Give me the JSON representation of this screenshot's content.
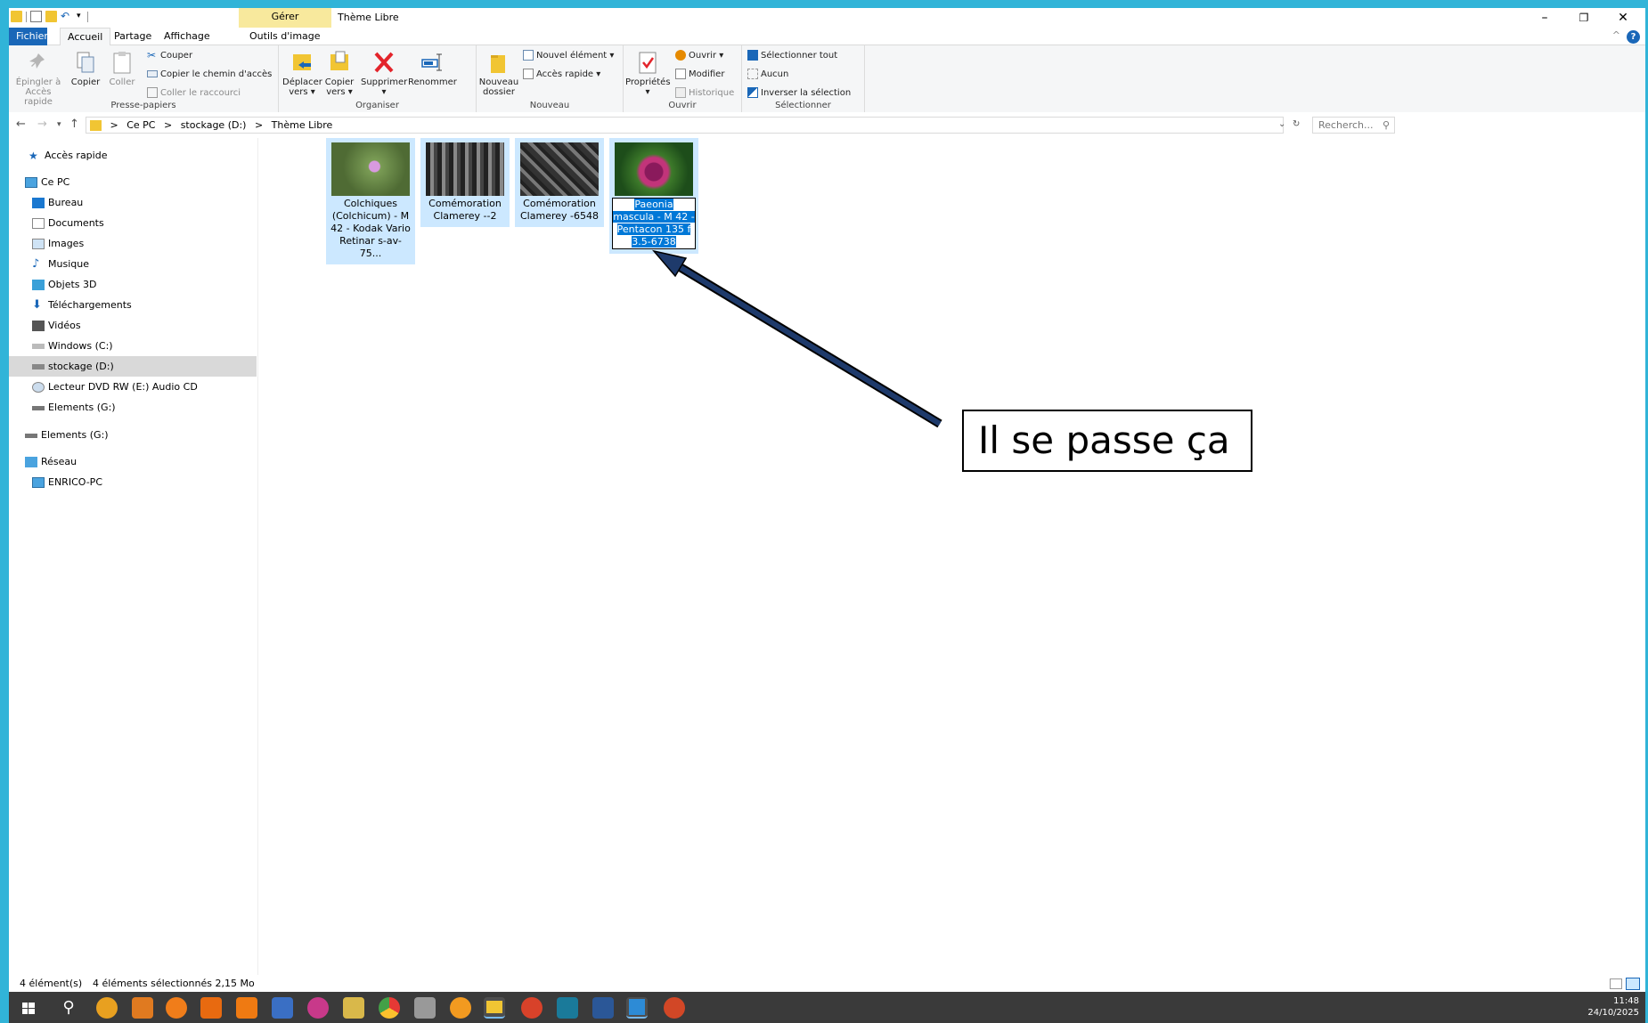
{
  "window": {
    "title": "Thème Libre",
    "contextual_tab_group": "Gérer"
  },
  "tabs": [
    {
      "label": "Fichier"
    },
    {
      "label": "Accueil"
    },
    {
      "label": "Partage"
    },
    {
      "label": "Affichage"
    },
    {
      "label": "Outils d'image"
    }
  ],
  "ribbon": {
    "clipboard": {
      "pin_line1": "Épingler à",
      "pin_line2": "Accès rapide",
      "copy": "Copier",
      "paste": "Coller",
      "cut": "Couper",
      "copy_path": "Copier le chemin d'accès",
      "paste_shortcut": "Coller le raccourci",
      "group": "Presse-papiers"
    },
    "organize": {
      "move_line1": "Déplacer",
      "move_line2": "vers ▾",
      "copyto_line1": "Copier",
      "copyto_line2": "vers ▾",
      "delete": "Supprimer",
      "delete_arrow": "▾",
      "rename": "Renommer",
      "group": "Organiser"
    },
    "new": {
      "newfolder_line1": "Nouveau",
      "newfolder_line2": "dossier",
      "new_item": "Nouvel élément ▾",
      "easy_access": "Accès rapide ▾",
      "group": "Nouveau"
    },
    "open": {
      "properties": "Propriétés",
      "properties_arrow": "▾",
      "open": "Ouvrir ▾",
      "edit": "Modifier",
      "history": "Historique",
      "group": "Ouvrir"
    },
    "select": {
      "select_all": "Sélectionner tout",
      "select_none": "Aucun",
      "invert": "Inverser la sélection",
      "group": "Sélectionner"
    }
  },
  "address": {
    "crumbs": [
      ">",
      "Ce PC",
      ">",
      "stockage (D:)",
      ">",
      "Thème Libre"
    ],
    "search_placeholder": "Recherch..."
  },
  "nav": {
    "items": [
      {
        "label": "Accès rapide"
      },
      {
        "label": "Ce PC"
      },
      {
        "label": "Bureau"
      },
      {
        "label": "Documents"
      },
      {
        "label": "Images"
      },
      {
        "label": "Musique"
      },
      {
        "label": "Objets 3D"
      },
      {
        "label": "Téléchargements"
      },
      {
        "label": "Vidéos"
      },
      {
        "label": "Windows (C:)"
      },
      {
        "label": "stockage (D:)"
      },
      {
        "label": "Lecteur DVD RW (E:) Audio CD"
      },
      {
        "label": "Elements (G:)"
      },
      {
        "label": "Elements (G:)"
      },
      {
        "label": "Réseau"
      },
      {
        "label": "ENRICO-PC"
      }
    ]
  },
  "files": [
    {
      "caption": "Colchiques (Colchicum) - M 42 - Kodak Vario Retinar s-av-75..."
    },
    {
      "caption": "Comémoration Clamerey --2"
    },
    {
      "caption": "Comémoration Clamerey -6548"
    },
    {
      "caption": "Paeonia mascula - M 42 - Pentacon 135 f  3.5-6738"
    }
  ],
  "status": {
    "count": "4 élément(s)",
    "selected": "4 éléments sélectionnés  2,15 Mo"
  },
  "annotation": {
    "text": "Il se passe ça"
  },
  "taskbar": {
    "time": "11:48",
    "date": "24/10/2025"
  }
}
